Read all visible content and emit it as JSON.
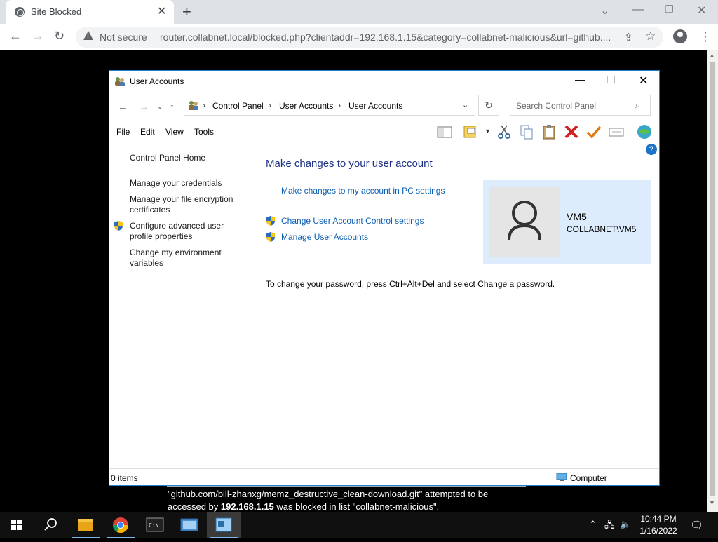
{
  "browser": {
    "tab_title": "Site Blocked",
    "not_secure_label": "Not secure",
    "url": "router.collabnet.local/blocked.php?clientaddr=192.168.1.15&category=collabnet-malicious&url=github...."
  },
  "window": {
    "title": "User Accounts",
    "breadcrumbs": [
      "Control Panel",
      "User Accounts",
      "User Accounts"
    ],
    "search_placeholder": "Search Control Panel",
    "menu": [
      "File",
      "Edit",
      "View",
      "Tools"
    ]
  },
  "left_pane": {
    "home": "Control Panel Home",
    "links": [
      "Manage your credentials",
      "Manage your file encryption certificates",
      "Configure advanced user profile properties",
      "Change my environment variables"
    ]
  },
  "main": {
    "heading": "Make changes to your user account",
    "pc_settings_link": "Make changes to my account in PC settings",
    "uac_link": "Change User Account Control settings",
    "manage_link": "Manage User Accounts",
    "password_hint": "To change your password, press Ctrl+Alt+Del and select Change a password.",
    "user_name": "VM5",
    "user_account": "COLLABNET\\VM5"
  },
  "status": {
    "items": "0 items",
    "zone": "Computer"
  },
  "block_message": {
    "line1": "\"github.com/bill-zhanxg/memz_destructive_clean-download.git\" attempted to be",
    "line2_pre": "accessed by ",
    "line2_ip": "192.168.1.15",
    "line2_post": " was blocked in list \"collabnet-malicious\"."
  },
  "taskbar": {
    "time": "10:44 PM",
    "date": "1/16/2022"
  },
  "colors": {
    "link": "#0b5fb3",
    "heading": "#1e3287",
    "user_card_bg": "#dcecfc",
    "window_border": "#1883d7"
  }
}
